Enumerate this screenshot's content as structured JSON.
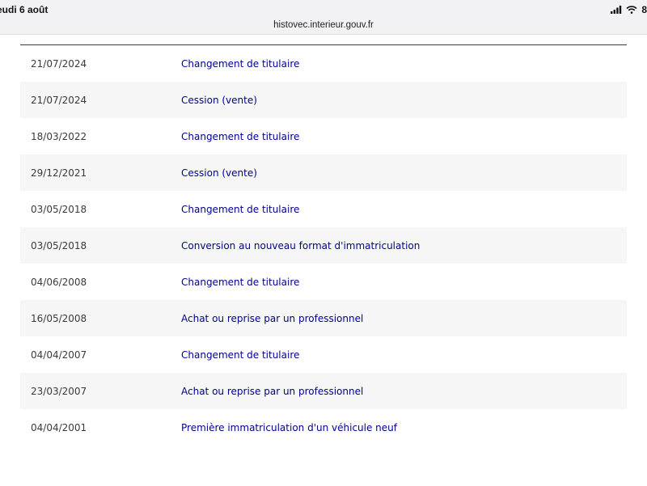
{
  "status_bar": {
    "date": "eudi 6 août",
    "battery": "8"
  },
  "browser": {
    "url": "histovec.interieur.gouv.fr"
  },
  "history": {
    "rows": [
      {
        "date": "21/07/2024",
        "event": "Changement de titulaire"
      },
      {
        "date": "21/07/2024",
        "event": "Cession (vente)"
      },
      {
        "date": "18/03/2022",
        "event": "Changement de titulaire"
      },
      {
        "date": "29/12/2021",
        "event": "Cession (vente)"
      },
      {
        "date": "03/05/2018",
        "event": "Changement de titulaire"
      },
      {
        "date": "03/05/2018",
        "event": "Conversion au nouveau format d'immatriculation"
      },
      {
        "date": "04/06/2008",
        "event": "Changement de titulaire"
      },
      {
        "date": "16/05/2008",
        "event": "Achat ou reprise par un professionnel"
      },
      {
        "date": "04/04/2007",
        "event": "Changement de titulaire"
      },
      {
        "date": "23/03/2007",
        "event": "Achat ou reprise par un professionnel"
      },
      {
        "date": "04/04/2001",
        "event": "Première immatriculation d'un véhicule neuf"
      }
    ]
  },
  "colors": {
    "link": "#000091",
    "stripe": "#f6f6f6"
  }
}
